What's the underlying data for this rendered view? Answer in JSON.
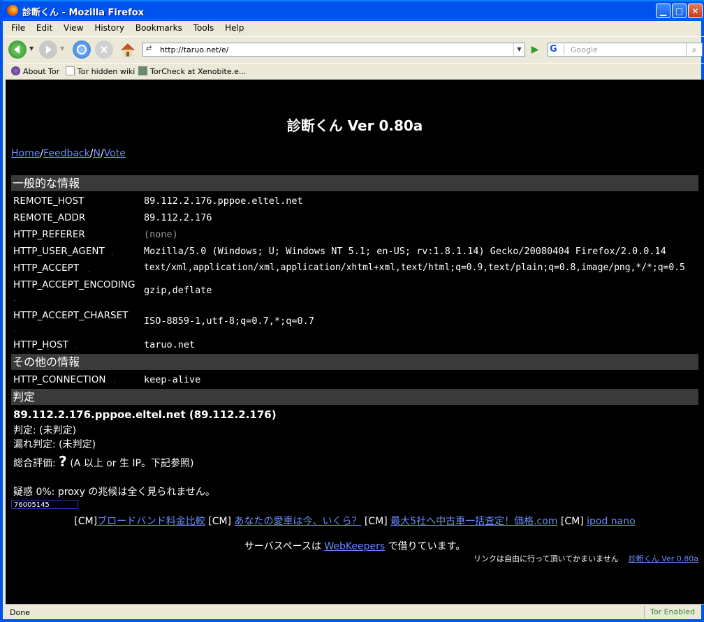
{
  "window": {
    "title": "診断くん - Mozilla Firefox"
  },
  "menu": [
    "File",
    "Edit",
    "View",
    "History",
    "Bookmarks",
    "Tools",
    "Help"
  ],
  "nav": {
    "url": "http://taruo.net/e/",
    "search_placeholder": "Google",
    "search_engine": "G"
  },
  "bookmarks": [
    "About Tor",
    "Tor hidden wiki",
    "TorCheck at Xenobite.e..."
  ],
  "page": {
    "title": "診断くん Ver 0.80a",
    "links": [
      "Home",
      "Feedback",
      "N",
      "Vote"
    ],
    "section_general": "一般的な情報",
    "section_other": "その他の情報",
    "section_verdict": "判定",
    "general_rows": [
      {
        "key": "REMOTE_HOST",
        "value": "89.112.2.176.pppoe.eltel.net"
      },
      {
        "key": "REMOTE_ADDR",
        "value": "89.112.2.176"
      },
      {
        "key": "HTTP_REFERER",
        "value": "(none)"
      },
      {
        "key": "HTTP_USER_AGENT",
        "value": "Mozilla/5.0 (Windows; U; Windows NT 5.1; en-US; rv:1.8.1.14) Gecko/20080404 Firefox/2.0.0.14"
      },
      {
        "key": "HTTP_ACCEPT",
        "value": "text/xml,application/xml,application/xhtml+xml,text/html;q=0.9,text/plain;q=0.8,image/png,*/*;q=0.5"
      },
      {
        "key": "HTTP_ACCEPT_ENCODING",
        "value": "gzip,deflate"
      },
      {
        "key": "HTTP_ACCEPT_CHARSET",
        "value": "ISO-8859-1,utf-8;q=0.7,*;q=0.7"
      },
      {
        "key": "HTTP_HOST",
        "value": "taruo.net"
      }
    ],
    "other_rows": [
      {
        "key": "HTTP_CONNECTION",
        "value": "keep-alive"
      }
    ],
    "verdict": {
      "host_line": "89.112.2.176.pppoe.eltel.net (89.112.2.176)",
      "judge": "判定: (未判定)",
      "leak": "漏れ判定: (未判定)",
      "overall_label": "総合評価:",
      "overall_mark": "?",
      "overall_note": "(A 以上 or 生 IP。下記参照)",
      "suspicion": "疑惑 0%: proxy の兆候は全く見られません。"
    },
    "counter": "76005145",
    "cm": [
      {
        "prefix": "[CM]",
        "text": "ブロードバンド料金比較"
      },
      {
        "prefix": "[CM]",
        "text": "あなたの愛車は今、いくら？"
      },
      {
        "prefix": "[CM]",
        "text": "最大5社へ中古車一括査定！価格.com"
      },
      {
        "prefix": "[CM]",
        "text": "ipod nano"
      }
    ],
    "footer": {
      "server_pre": "サーバスペースは",
      "server_link": "WebKeepers",
      "server_post": "で借りています。",
      "link_note": "リンクは自由に行って頂いてかまいません",
      "version_link": "診断くん Ver 0.80a"
    }
  },
  "status": {
    "text": "Done",
    "tor": "Tor Enabled"
  },
  "colors": {
    "link": "#6B8CFF",
    "section_bg": "#3A3A3A",
    "page_bg": "#000000"
  }
}
